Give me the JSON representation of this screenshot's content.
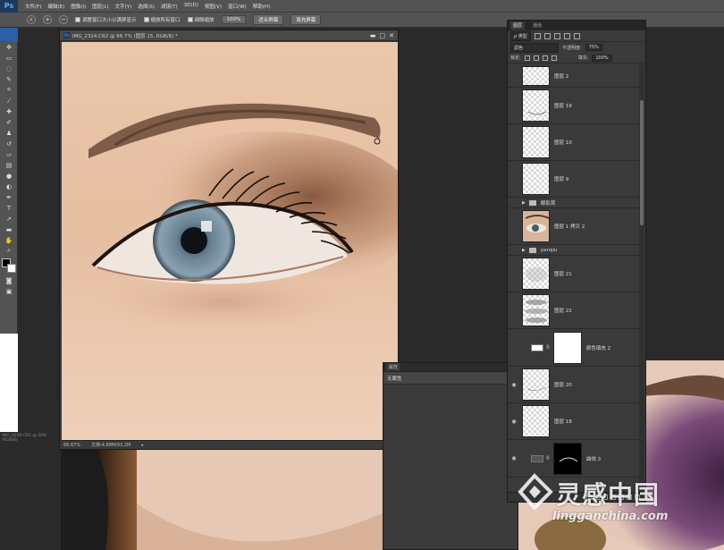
{
  "app": {
    "logo": "Ps"
  },
  "menu": [
    "文件(F)",
    "编辑(E)",
    "图像(I)",
    "图层(L)",
    "文字(Y)",
    "选择(S)",
    "滤镜(T)",
    "3D(D)",
    "视图(V)",
    "窗口(W)",
    "帮助(H)"
  ],
  "options_bar": {
    "check1": "调整窗口大小以满屏显示",
    "check2": "缩放所有窗口",
    "check3": "细微缩放",
    "zoom_value": "100%",
    "fit_screen": "适合屏幕",
    "fill_screen": "填充屏幕"
  },
  "document": {
    "title": "IMG_2324.CR2 @ 66.7% (图层 15, RGB/8) *",
    "zoom": "66.67%",
    "doc_size": "文档:4.88M/93.2M"
  },
  "left_status": "IMG_0209.CR2 @ 50%(RGB/8)",
  "properties": {
    "tab": "属性",
    "content": "无属性"
  },
  "layers_panel": {
    "tabs": [
      "图层",
      "通道"
    ],
    "filter_kind": "ρ 类型",
    "blend_mode": "滤色",
    "opacity_label": "不透明度:",
    "opacity_value": "75%",
    "lock_label": "锁定:",
    "fill_label": "填充:",
    "fill_value": "100%",
    "layers": [
      {
        "name": "图层 2",
        "type": "pixel",
        "visible": false
      },
      {
        "name": "图层 19",
        "type": "pixel",
        "visible": false
      },
      {
        "name": "图层 10",
        "type": "pixel",
        "visible": false
      },
      {
        "name": "图层 9",
        "type": "pixel",
        "visible": false
      },
      {
        "name": "眼影窝",
        "type": "group",
        "visible": false
      },
      {
        "name": "图层 1 拷贝 2",
        "type": "photo",
        "visible": false
      },
      {
        "name": "yanqiu",
        "type": "group",
        "visible": false
      },
      {
        "name": "图层 21",
        "type": "pixel",
        "visible": false
      },
      {
        "name": "图层 22",
        "type": "pixel",
        "visible": false
      },
      {
        "name": "颜色填充 2",
        "type": "fill",
        "visible": false
      },
      {
        "name": "图层 20",
        "type": "pixel",
        "visible": true
      },
      {
        "name": "图层 18",
        "type": "pixel",
        "visible": true
      },
      {
        "name": "曲线 3",
        "type": "curves",
        "visible": true
      }
    ]
  },
  "watermark": {
    "cn": "灵感中国",
    "en": "lingganchina.com"
  },
  "colors": {
    "panel_bg": "#3a3a3a",
    "menu_bg": "#535353",
    "ps_blue": "#4fb3ff",
    "skin": "#e8c4a8"
  }
}
